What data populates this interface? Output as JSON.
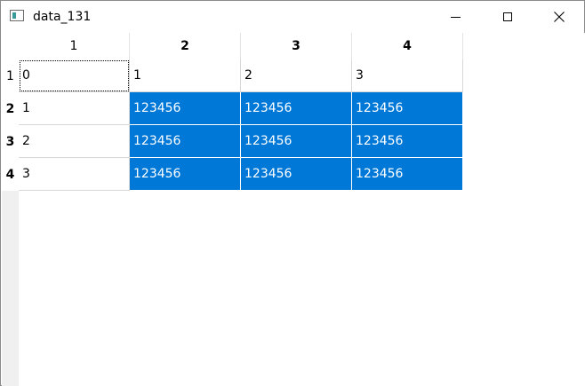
{
  "window": {
    "title": "data_131",
    "icon": "window-app-icon",
    "controls": [
      "minimize-icon",
      "maximize-icon",
      "close-icon"
    ]
  },
  "table": {
    "column_headers": [
      "1",
      "2",
      "3",
      "4"
    ],
    "row_headers": [
      "1",
      "2",
      "3",
      "4"
    ],
    "rows": [
      [
        "0",
        "1",
        "2",
        "3"
      ],
      [
        "1",
        "123456",
        "123456",
        "123456"
      ],
      [
        "2",
        "123456",
        "123456",
        "123456"
      ],
      [
        "3",
        "123456",
        "123456",
        "123456"
      ]
    ],
    "current_cell": "row 1, column 1",
    "selected_range": "rows 2-4, columns 2-4",
    "selection_color": "#0078d7"
  }
}
